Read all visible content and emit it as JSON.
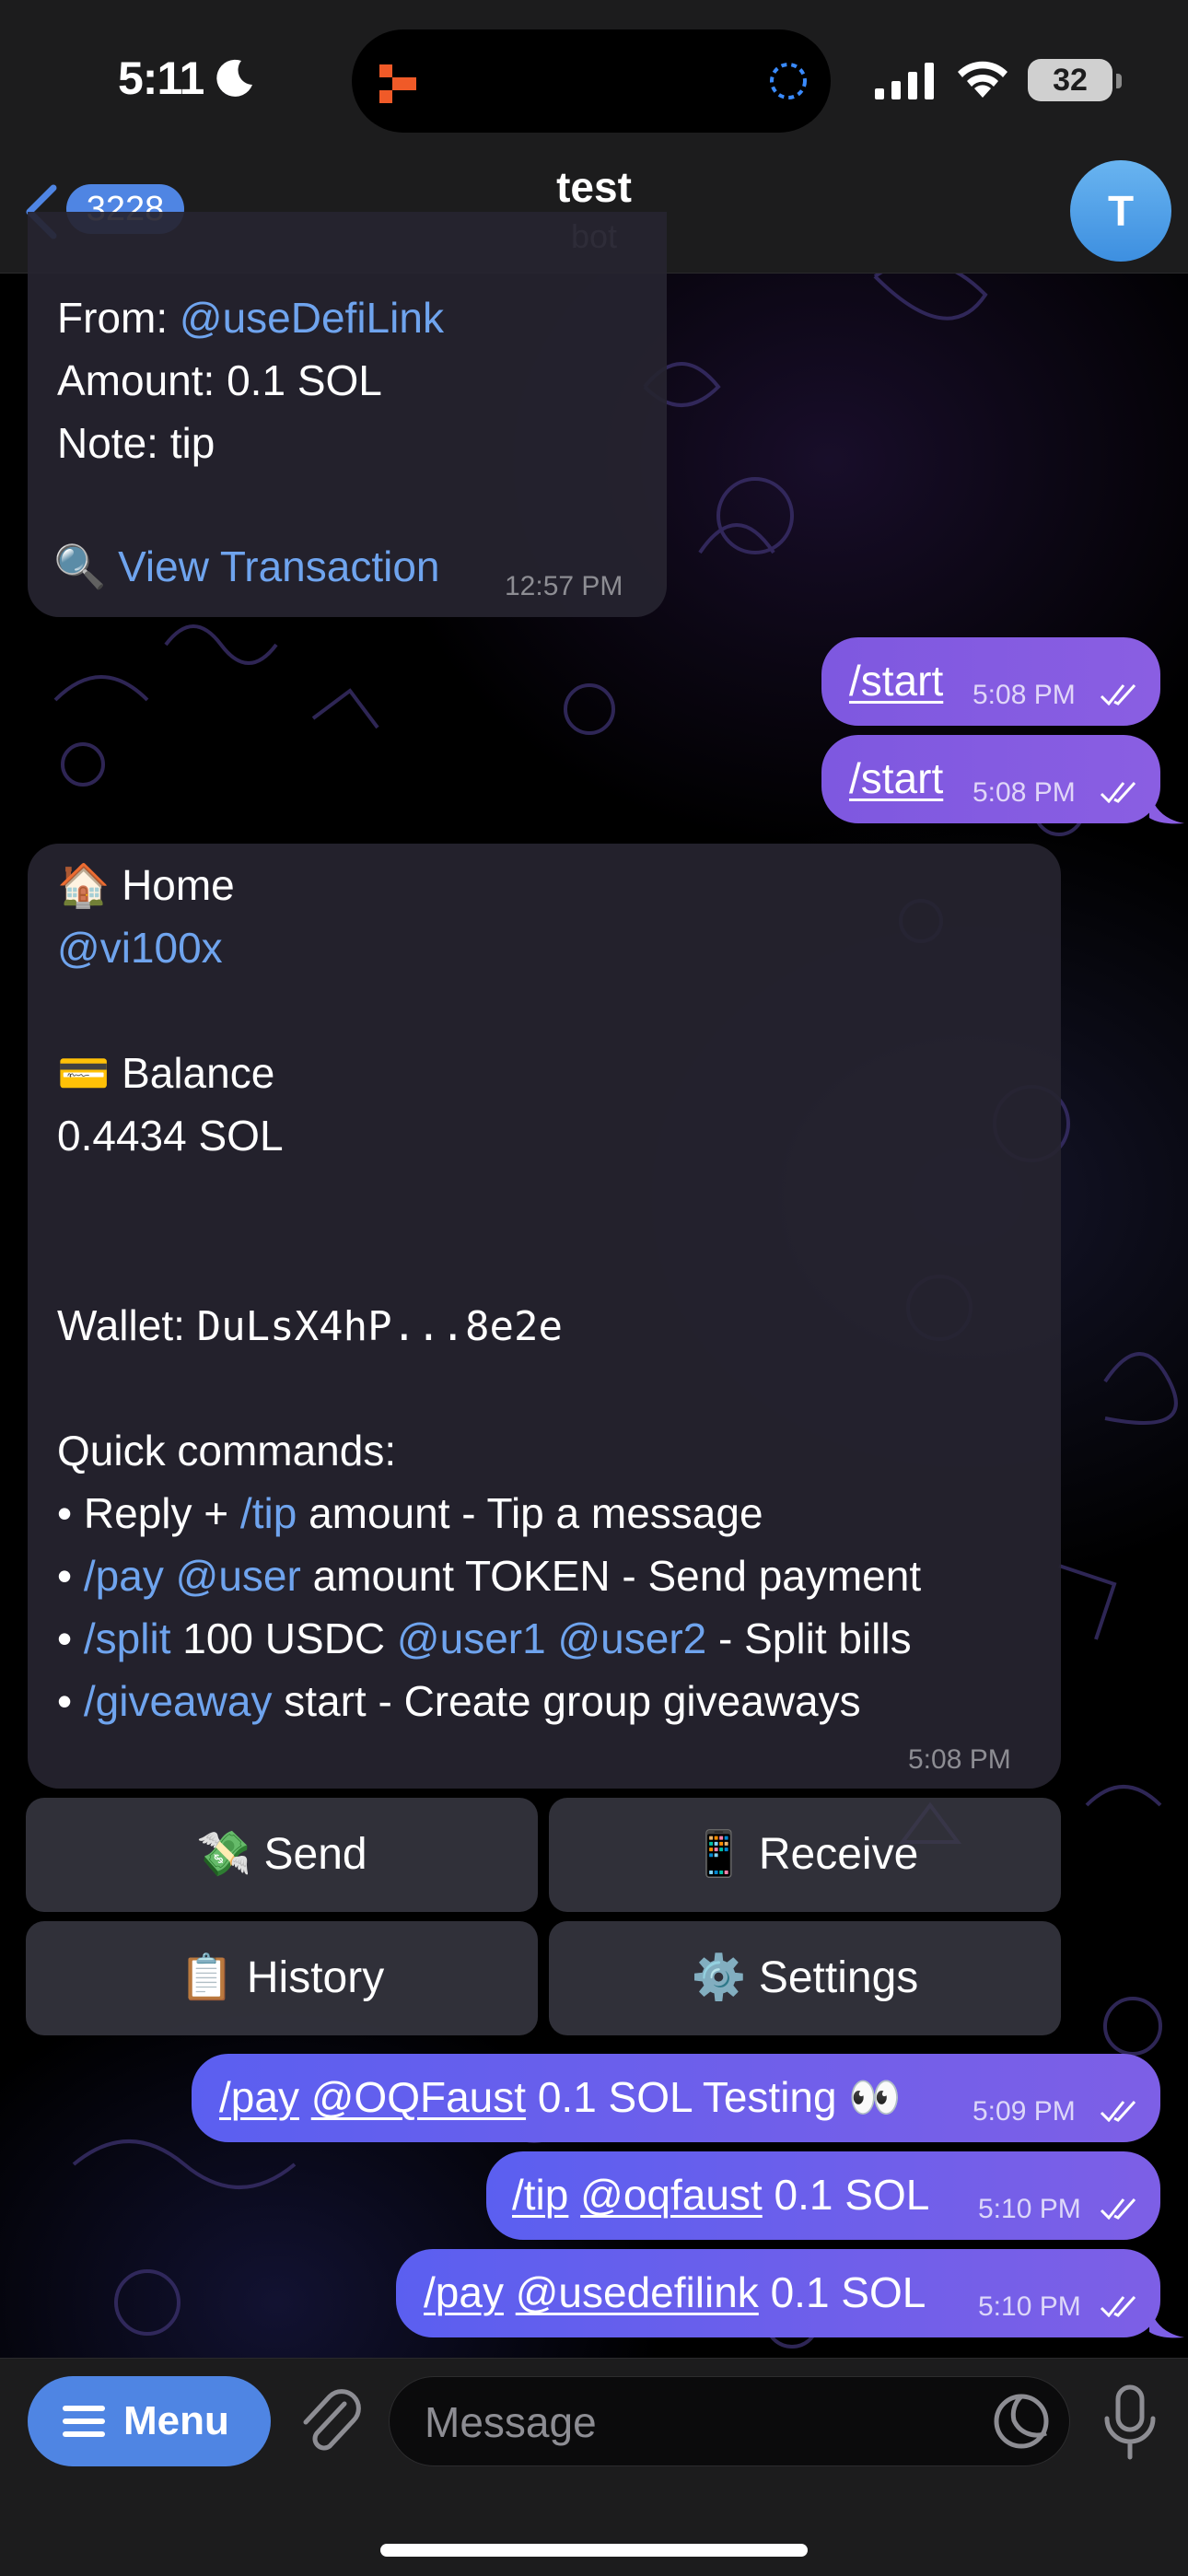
{
  "status_bar": {
    "time": "5:11",
    "battery": "32"
  },
  "nav": {
    "back_count": "3228",
    "title": "test",
    "subtitle": "bot",
    "avatar_letter": "T"
  },
  "messages": {
    "tx": {
      "from_label": "From: ",
      "from_user": "@useDefiLink",
      "amount": "Amount: 0.1 SOL",
      "note": "Note: tip",
      "view_tx_icon": "🔍",
      "view_tx": "View Transaction",
      "time": "12:57 PM"
    },
    "start1": {
      "text": "/start",
      "time": "5:08 PM"
    },
    "start2": {
      "text": "/start",
      "time": "5:08 PM"
    },
    "home": {
      "home_icon": "🏠",
      "home_title": "Home",
      "username": "@vi100x",
      "balance_icon": "💳",
      "balance_title": "Balance",
      "balance_value": "0.4434 SOL",
      "wallet_label": "Wallet: ",
      "wallet_address": "DuLsX4hP...8e2e",
      "quick_title": "Quick commands:",
      "cmd1": {
        "bullet": "• ",
        "pre": "Reply + ",
        "cmd": "/tip",
        "rest": " amount - Tip a message"
      },
      "cmd2": {
        "bullet": "• ",
        "cmd": "/pay",
        "sp": " ",
        "user": "@user",
        "rest": " amount TOKEN - Send payment"
      },
      "cmd3": {
        "bullet": "• ",
        "cmd": "/split",
        "mid": " 100 USDC ",
        "user1": "@user1",
        "sp": " ",
        "user2": "@user2",
        "rest": " - Split bills"
      },
      "cmd4": {
        "bullet": "• ",
        "cmd": "/giveaway",
        "rest": " start - Create group giveaways"
      },
      "time": "5:08 PM"
    },
    "pay1": {
      "cmd": "/pay",
      "user": "@OQFaust",
      "rest": " 0.1 SOL Testing 👀",
      "time": "5:09 PM"
    },
    "tip1": {
      "cmd": "/tip",
      "user": "@oqfaust",
      "rest": " 0.1 SOL",
      "time": "5:10 PM"
    },
    "pay2": {
      "cmd": "/pay",
      "user": "@usedefilink",
      "rest": " 0.1 SOL",
      "time": "5:10 PM"
    }
  },
  "keyboard": {
    "send": {
      "icon": "💸",
      "label": "Send"
    },
    "receive": {
      "icon": "📱",
      "label": "Receive"
    },
    "history": {
      "icon": "📋",
      "label": "History"
    },
    "settings": {
      "icon": "⚙️",
      "label": "Settings"
    }
  },
  "input": {
    "menu_label": "Menu",
    "placeholder": "Message"
  },
  "colors": {
    "accent": "#4f85e3",
    "link": "#6fa4ee",
    "outgoing": "#6a5ee8"
  }
}
